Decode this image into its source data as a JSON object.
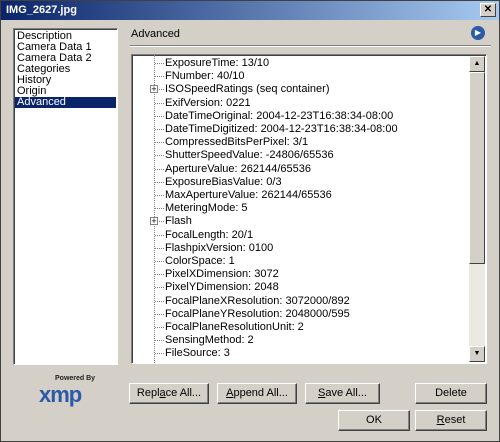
{
  "window": {
    "title": "IMG_2627.jpg",
    "close_glyph": "✕"
  },
  "categories": [
    {
      "label": "Description"
    },
    {
      "label": "Camera Data 1"
    },
    {
      "label": "Camera Data 2"
    },
    {
      "label": "Categories"
    },
    {
      "label": "History"
    },
    {
      "label": "Origin"
    },
    {
      "label": "Advanced",
      "selected": true
    }
  ],
  "branding": {
    "powered_by": "Powered By",
    "logo": "xmp"
  },
  "panel": {
    "heading": "Advanced",
    "menu_icon": "flyout-menu-icon"
  },
  "tree_rows": [
    {
      "text": "ExposureTime: 13/10"
    },
    {
      "text": "FNumber: 40/10"
    },
    {
      "text": "ISOSpeedRatings (seq container)",
      "expandable": true
    },
    {
      "text": "ExifVersion: 0221"
    },
    {
      "text": "DateTimeOriginal: 2004-12-23T16:38:34-08:00"
    },
    {
      "text": "DateTimeDigitized: 2004-12-23T16:38:34-08:00"
    },
    {
      "text": "CompressedBitsPerPixel: 3/1"
    },
    {
      "text": "ShutterSpeedValue: -24806/65536"
    },
    {
      "text": "ApertureValue: 262144/65536"
    },
    {
      "text": "ExposureBiasValue: 0/3"
    },
    {
      "text": "MaxApertureValue: 262144/65536"
    },
    {
      "text": "MeteringMode: 5"
    },
    {
      "text": "Flash",
      "expandable": true
    },
    {
      "text": "FocalLength: 20/1"
    },
    {
      "text": "FlashpixVersion: 0100"
    },
    {
      "text": "ColorSpace: 1"
    },
    {
      "text": "PixelXDimension: 3072"
    },
    {
      "text": "PixelYDimension: 2048"
    },
    {
      "text": "FocalPlaneXResolution: 3072000/892"
    },
    {
      "text": "FocalPlaneYResolution: 2048000/595"
    },
    {
      "text": "FocalPlaneResolutionUnit: 2"
    },
    {
      "text": "SensingMethod: 2"
    },
    {
      "text": "FileSource: 3"
    }
  ],
  "buttons": {
    "replace_all": {
      "pre": "Repl",
      "u": "a",
      "post": "ce All..."
    },
    "append_all": {
      "pre": "",
      "u": "A",
      "post": "ppend All..."
    },
    "save_all": {
      "pre": "",
      "u": "S",
      "post": "ave All..."
    },
    "delete": {
      "pre": "",
      "u": "",
      "post": "Delete"
    },
    "ok": {
      "pre": "",
      "u": "",
      "post": "OK"
    },
    "reset": {
      "pre": "",
      "u": "R",
      "post": "eset"
    }
  },
  "colors": {
    "selection": "#0a246a",
    "title_start": "#0a246a",
    "title_end": "#a6caf0",
    "xmp_blue": "#2a5aa8"
  }
}
